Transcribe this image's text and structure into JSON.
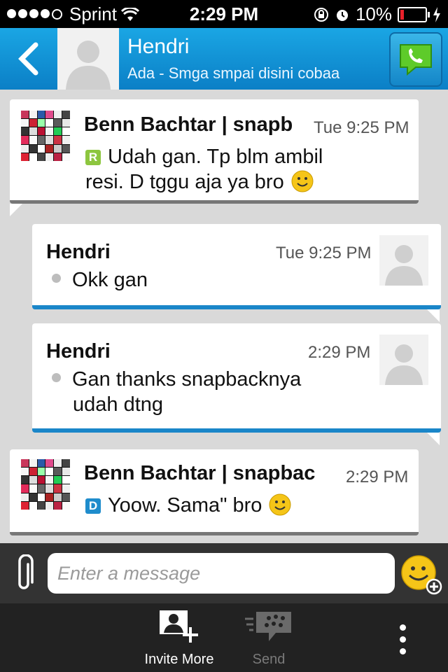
{
  "status_bar": {
    "carrier": "Sprint",
    "time": "2:29 PM",
    "battery": "10%",
    "battery_level": 0.1
  },
  "header": {
    "contact_name": "Hendri",
    "contact_status": "Ada - Smga smpai disini cobaa"
  },
  "messages": [
    {
      "sender": "Benn Bachtar | snapb",
      "time": "Tue 9:25 PM",
      "status": "R",
      "status_color": "#8dc63f",
      "lines": [
        "Udah gan. Tp blm ambil",
        "resi. D tggu aja ya bro"
      ],
      "emoji": "smiley-icon"
    },
    {
      "sender": "Hendri",
      "time": "Tue 9:25 PM",
      "lines": [
        "Okk gan"
      ]
    },
    {
      "sender": "Hendri",
      "time": "2:29 PM",
      "lines": [
        "Gan thanks snapbacknya",
        "udah dtng"
      ]
    },
    {
      "sender": "Benn Bachtar | snapbac",
      "time": "2:29 PM",
      "status": "D",
      "status_color": "#1f8ccc",
      "lines": [
        "Yoow. Sama\" bro"
      ],
      "emoji": "smiley-icon"
    }
  ],
  "composer": {
    "placeholder": "Enter a message"
  },
  "toolbar": {
    "invite_label": "Invite More",
    "send_label": "Send"
  },
  "colors": {
    "header_blue": "#1296d8",
    "outgoing_border": "#1a86c9",
    "incoming_border": "#777777",
    "call_green": "#5ecb2a"
  }
}
